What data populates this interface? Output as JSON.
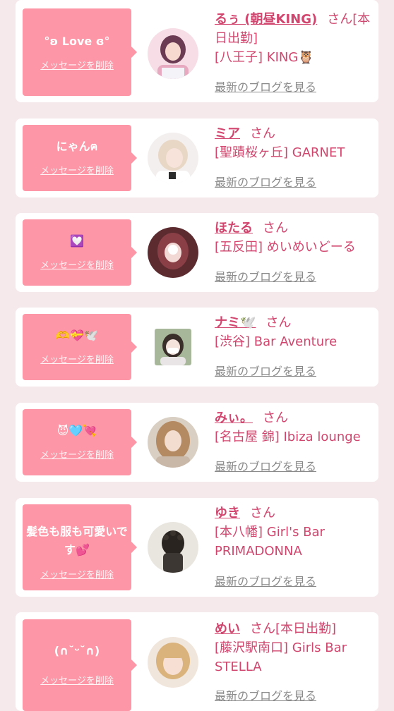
{
  "colors": {
    "page_bg": "#f5e9ec",
    "bubble_bg": "#fd96a6",
    "accent_text": "#d0466e",
    "blog_link": "#8a8a8a"
  },
  "delete_label": "メッセージを削除",
  "blog_label": "最新のブログを見る",
  "items": [
    {
      "message": "°ʚ Love ɞ°",
      "name": "るぅ (朝昼KING)",
      "suffix": "さん[本日出勤]",
      "shop": "[八王子] KING🦉",
      "avatar_icon": "girl-portrait-icon"
    },
    {
      "message": "にゃんฅ",
      "name": "ミア",
      "suffix": "さん",
      "shop": "[聖蹟桜ヶ丘] GARNET",
      "avatar_icon": "girl-portrait-icon"
    },
    {
      "message": "💟",
      "name": "ほたる",
      "suffix": "さん",
      "shop": "[五反田] めいめいどーる",
      "avatar_icon": "girl-portrait-icon"
    },
    {
      "message": "🫶💝🕊️",
      "name": "ナミ🕊️",
      "suffix": "さん",
      "shop": "[渋谷] Bar Aventure",
      "avatar_icon": "girl-portrait-icon"
    },
    {
      "message": "😈🩵💘",
      "name": "みぃ。",
      "suffix": "さん",
      "shop": "[名古屋 錦] Ibiza lounge",
      "avatar_icon": "girl-portrait-icon"
    },
    {
      "message": "髪色も服も可愛いです💕",
      "name": "ゆき",
      "suffix": "さん",
      "shop": "[本八幡] Girl's Bar PRIMADONNA",
      "avatar_icon": "hair-back-icon"
    },
    {
      "message": "(∩˘ᵕ˘∩)",
      "name": "めい",
      "suffix": "さん[本日出勤]",
      "shop": "[藤沢駅南口] Girls Bar STELLA",
      "avatar_icon": "girl-portrait-icon"
    }
  ]
}
